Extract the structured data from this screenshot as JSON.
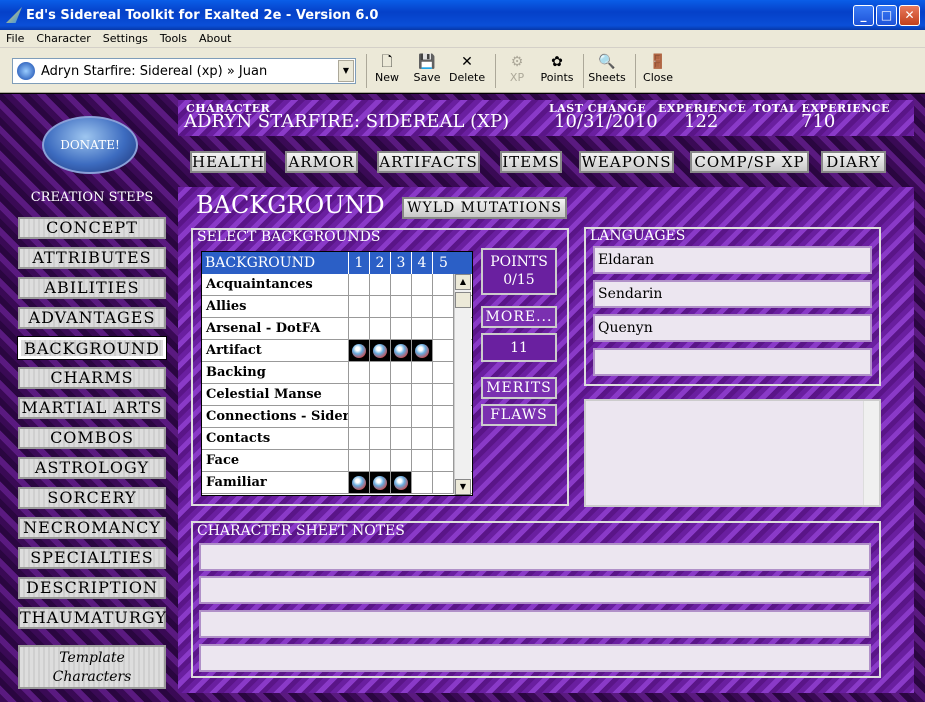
{
  "window": {
    "title": "Ed's Sidereal Toolkit for Exalted 2e - Version 6.0"
  },
  "menu": [
    "File",
    "Character",
    "Settings",
    "Tools",
    "About"
  ],
  "toolbar": {
    "character_select": "Adryn Starfire: Sidereal (xp) » Juan",
    "buttons": {
      "new": "New",
      "save": "Save",
      "delete": "Delete",
      "xp": "XP",
      "points": "Points",
      "sheets": "Sheets",
      "close": "Close"
    }
  },
  "donate": "DONATE!",
  "creation_steps": {
    "title": "CREATION STEPS",
    "items": [
      "CONCEPT",
      "ATTRIBUTES",
      "ABILITIES",
      "ADVANTAGES",
      "BACKGROUND",
      "CHARMS",
      "MARTIAL ARTS",
      "COMBOS",
      "ASTROLOGY",
      "SORCERY",
      "NECROMANCY",
      "SPECIALTIES",
      "DESCRIPTION",
      "THAUMATURGY"
    ],
    "active": "BACKGROUND",
    "template_line1": "Template",
    "template_line2": "Characters"
  },
  "header": {
    "character_label": "CHARACTER",
    "character": "ADRYN STARFIRE: SIDEREAL (XP)",
    "last_change_label": "LAST CHANGE",
    "last_change": "10/31/2010",
    "experience_label": "EXPERIENCE",
    "experience": "122",
    "total_label": "TOTAL EXPERIENCE",
    "total": "710"
  },
  "nav": [
    "HEALTH",
    "ARMOR",
    "ARTIFACTS",
    "ITEMS",
    "WEAPONS",
    "COMP/SP XP",
    "DIARY"
  ],
  "section": {
    "title": "BACKGROUND",
    "wyld": "WYLD MUTATIONS",
    "select_label": "SELECT BACKGROUNDS"
  },
  "grid": {
    "header": "BACKGROUND",
    "cols": [
      "1",
      "2",
      "3",
      "4",
      "5"
    ],
    "rows": [
      {
        "name": "Acquaintances",
        "dots": 0
      },
      {
        "name": "Allies",
        "dots": 0
      },
      {
        "name": "Arsenal - DotFA",
        "dots": 0
      },
      {
        "name": "Artifact",
        "dots": 4
      },
      {
        "name": "Backing",
        "dots": 0
      },
      {
        "name": "Celestial Manse",
        "dots": 0
      },
      {
        "name": "Connections - Sidere",
        "dots": 0
      },
      {
        "name": "Contacts",
        "dots": 0
      },
      {
        "name": "Face",
        "dots": 0
      },
      {
        "name": "Familiar",
        "dots": 3
      }
    ]
  },
  "points": {
    "label": "POINTS",
    "value": "0/15"
  },
  "more": {
    "label": "MORE...",
    "value": "11"
  },
  "merits": "MERITS",
  "flaws": "FLAWS",
  "languages": {
    "label": "LANGUAGES",
    "items": [
      "Eldaran",
      "Sendarin",
      "Quenyn",
      ""
    ]
  },
  "notes": {
    "label": "CHARACTER SHEET NOTES"
  }
}
